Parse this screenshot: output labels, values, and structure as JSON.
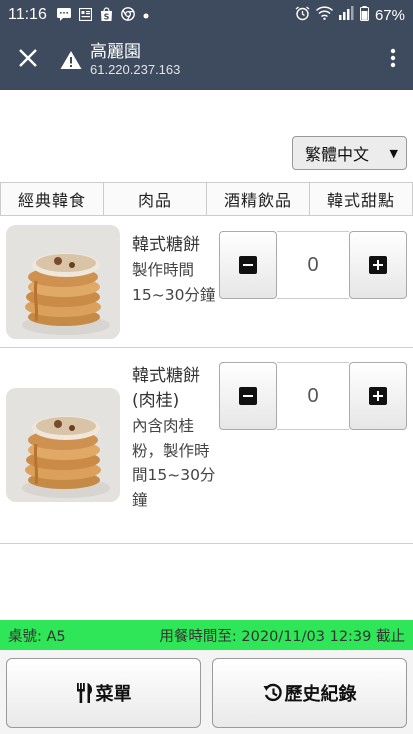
{
  "status_bar": {
    "time": "11:16",
    "battery": "67%",
    "icons": [
      "message-icon",
      "news-icon",
      "shopping-bag-icon",
      "chrome-icon",
      "dot-icon",
      "alarm-icon",
      "wifi-icon",
      "signal-icon",
      "battery-icon"
    ]
  },
  "header": {
    "title": "高麗園",
    "url": "61.220.237.163",
    "close_icon": "close-icon",
    "warning_icon": "warning-icon",
    "menu_icon": "more-vertical-icon"
  },
  "language": {
    "selected": "繁體中文"
  },
  "tabs": [
    {
      "label": "經典韓食"
    },
    {
      "label": "肉品"
    },
    {
      "label": "酒精飲品"
    },
    {
      "label": "韓式甜點"
    }
  ],
  "items": [
    {
      "name": "韓式糖餅",
      "description": "製作時間15~30分鐘",
      "quantity": "0",
      "image": "korean-sweet-pancake-photo"
    },
    {
      "name": "韓式糖餅(肉桂)",
      "description": "內含肉桂粉，製作時間15~30分鐘",
      "quantity": "0",
      "image": "korean-sweet-pancake-cinnamon-photo"
    }
  ],
  "info_bar": {
    "table": "桌號: A5",
    "deadline": "用餐時間至: 2020/11/03 12:39 截止",
    "color": "#2ee657"
  },
  "bottom": {
    "menu_label": "菜單",
    "history_label": "歷史紀錄"
  },
  "colors": {
    "header_bg": "#3e4a5d"
  }
}
